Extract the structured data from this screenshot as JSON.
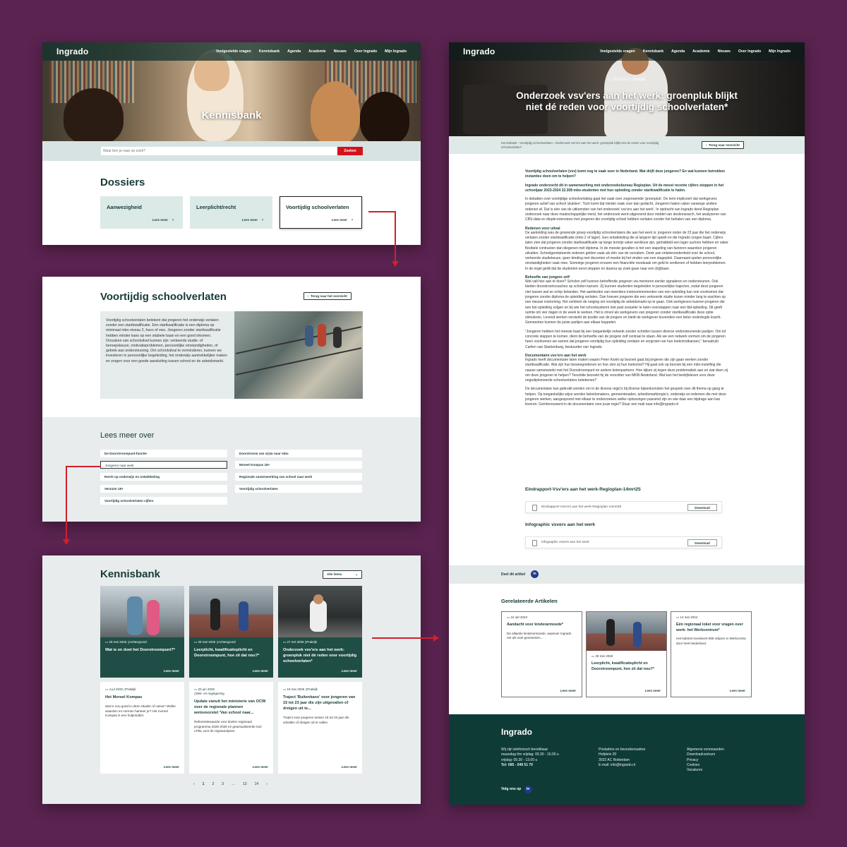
{
  "nav": {
    "logo": "Ingrado",
    "links": [
      "Veelgestelde vragen",
      "Kennisbank",
      "Agenda",
      "Academie",
      "Nieuws",
      "Over Ingrado",
      "Mijn Ingrado"
    ]
  },
  "panel1": {
    "hero_title": "Kennisbank",
    "search_placeholder": "Waar ben je naar op zoek?",
    "search_button": "Zoeken",
    "section_title": "Dossiers",
    "dossiers": [
      {
        "title": "Aanwezigheid",
        "more": "Lees meer"
      },
      {
        "title": "Leerplicht/recht",
        "more": "Lees meer"
      },
      {
        "title": "Voortijdig schoolverlaten",
        "more": "Lees meer"
      }
    ]
  },
  "panel2": {
    "title": "Voortijdig schoolverlaten",
    "back": "Terug naar het overzicht",
    "intro": "Voortijdig schoolverlaten betekent dat jongeren het onderwijs verlaten zonder een startkwalificatie. Een startkwalificatie is een diploma op minimaal mbo-niveau 2, havo of vwo. Jongeren zonder startkwalificatie hebben minder kans op een stabiele baan en een goed inkomen. Oorzaken van schooluitval kunnen zijn: verkeerde studie- of beroepskeuze, motivatieproblemen, persoonlijke omstandigheden, of gebrek aan ondersteuning. Om schooluitval te verminderen, kunnen we investeren in persoonlijke begeleiding, het onderwijs aantrekkelijker maken en zorgen voor een goede aansluiting tussen school en de arbeidsmarkt.",
    "read_more_title": "Lees meer over",
    "links_left": [
      "De Doorstroompunt-functie",
      "Jongeren naar werk",
      "Recht op onderwijs en ontwikkeling",
      "Verzuim 18+",
      "Voortijdig schoolverlaten cijfers"
    ],
    "links_right": [
      "Doorstroom van v(s)o naar mbo",
      "Moreel Kompas 18+",
      "Regionale samenwerking van school naar werk",
      "Voortijdig schoolverlaten"
    ]
  },
  "panel3": {
    "title": "Kennisbank",
    "filter": "Alle items",
    "cards": [
      {
        "meta": "29 mei 2025",
        "tag": "Achtergrond",
        "title": "Wat is en doet het Doorstroompunt?*",
        "desc": "",
        "more": "Lees meer"
      },
      {
        "meta": "29 mei 2025",
        "tag": "Achtergrond",
        "title": "Leerplicht, kwalificatieplicht en Doorstroompunt, hoe zit dat nou?*",
        "desc": "",
        "more": "Lees meer"
      },
      {
        "meta": "27 mrt 2025",
        "tag": "Praktijk",
        "title": "Onderzoek vsv'ers aan het werk: groenpluk niet dé reden voor voortijdig schoolverlaten*",
        "desc": "",
        "more": "Lees meer"
      },
      {
        "meta": "4 jul 2025",
        "tag": "Praktijk",
        "title": "Het Moreel Kompas",
        "desc": "Wat is nou goed in deze situatie of casus? Welke waarden en normen hanteer je? Het moreel Kompas is een hulpmiddel.",
        "more": "Lees meer"
      },
      {
        "meta": "20 jun 2025",
        "tag": "Wet- en regelgeving",
        "title": "Update vanuit het ministerie van OCW over de regionale plannen wetsvoorstel 'Van school naar...",
        "desc": "Referentiewaarde voor doelen regionaal programma 2026-2029 en geactualiseerde tool LPBL voor de regioanalyses.",
        "more": "Lees meer"
      },
      {
        "meta": "19 mei 2025",
        "tag": "Praktijk",
        "title": "Traject 'Buitenkans' voor jongeren van 15 tot 23 jaar die zijn uitgevallen of dreigen uit te...",
        "desc": "Traject voor jongeren tussen 15 tot 23 jaar die uitvallen of dreigen uit te vallen",
        "more": "Lees meer"
      }
    ],
    "pager": [
      "‹",
      "1",
      "2",
      "3",
      "…",
      "13",
      "14",
      "›"
    ]
  },
  "panel4": {
    "meta_date": "2025-03-27",
    "meta_tag": "Praktijk",
    "hero_title": "Onderzoek vsv'ers aan het werk: groenpluk blijkt niet dé reden voor voortijdig schoolverlaten*",
    "breadcrumb": "Kennisbank  ›  Voortijdig schoolverlaten  ›  Onderzoek vsv'ers aan het werk: groenpluk blijkt niet de reden voor voortijdig schoolverlaten*",
    "back": "Terug naar overzicht",
    "lead1": "Voortijdig schoolverlaten (vsv) komt nog te vaak voor in Nederland. Wat drijft deze jongeren? En wat kunnen betrokken instanties doen om te helpen?",
    "lead2": "Ingrado onderzocht dit in samenwerking met onderzoeksbureau Regioplan. Uit de meest recente cijfers stoppen in het schooljaar 2023-2024 22.308 mbo-studenten met hun opleiding zonder startkwalificatie te halen.",
    "p1": "In debatten over voortijdige schoolverlating gaat het vaak over zogenoemde 'groenpluk'. De term impliceert dat werkgevers jongeren actief van school 'plukken'. Toch komt dat minder vaak voor dan gedacht. Jongeren haken vaker vanwege andere redenen af. Dat is één van de uitkomsten van het onderzoek 'vsv'ers aan het werk'. In opdracht van Ingrado deed Regioplan onderzoek naar deze maatschappelijke trend, het onderzoek werd uitgevoerd door middel van deskresearch, het analyseren van CBS-data en diepte-interviews met jongeren die voortijdig school hebben verlaten zonder het behalen van een diploma.",
    "h1": "Redenen voor uitval",
    "p2": "De aanleiding was de groeiende groep voortijdig schoolverlaters die aan het werk is: jongeren onder de 23 jaar die het onderwijs verlaten zonder startkwalificatie (mbo 2 of lager). Een ontwikkeling die al langere tijd speelt en die Ingrado zorgen baart. Cijfers laten zien dat jongeren zonder startkwalificatie op lange termijn vaker werkloos zijn, gemiddeld een lager uurloon hebben en vaker flexibele contracten dan diegenen mét diploma. In de meeste gevallen is het een stapeling van factoren waardoor jongeren uitvallen. Schoolgerelateerde redenen gelden vaak als één van de oorzaken. Denk aan onbetevredenheid over de school, verkeerde studiekeuze, geen binding met docenten of moeite bij het vinden van een stageplek. Daarnaast spelen persoonlijke omstandigheden vaak mee. Sommige jongeren ervaren een financiële noodzaak om geld te verdienen of hebben leerproblemen. In de regel geldt dat de studenten eerst stoppen en daarna op zoek gaan naar een (bij)baan.",
    "h2": "Behoefte van jongere zelf",
    "p3": "Wat valt hier aan te doen? Scholen zelf kunnen betreffende jongeren via mentoren eerder signaleren en ondersteunen. Ook bieden doorstroomcoaches op scholen kansen. Zij kunnen studenten begeleiden in persoonlijke trajecten, zodat deze jongeren niet tussen wal en schip belanden. Het aanbieden van meerdere instroommomenten van een opleiding kan ook voorkomen dat jongeren zonder diploma de opleiding verlaten. Dan hoeven jongeren die een verkeerde studie kozen minder lang te wachten op een nieuwe instroming. Het verkleint de neiging om voortijdig de arbeidsmarkt op te gaan. Ook werkgevers kunnen jongeren die een bol-opleiding volgen en bij wie het schoolsysteem niet past soepeler te laten overstappen naar een bbl-opleiding. Dit geeft ruimte om vier dagen in de week te werken. Het is zinvol als werkgevers van jongeren zonder startkwalificatie deze optie stimuleren. Levend werken versterkt de positie van de jongere en biedt de werkgever bovendien een beter onderlegde kracht. Gemeenten kunnen de juiste partijen aan elkaar koppelen.",
    "p4": "\"Jongeren hebben het meeste baat bij een toegankelijk netwerk zonder schotten tussen diverse ondersteunende partijen. Om tot concrete stappen te komen, dient de behoefte van de jongere zelf centraal te staan. Als we een netwerk vormen om de jongeren heen voorkomen we samen dat jongeren voortijdig hun opleiding verlaten en vergroten we hun toekomstkansen,\" benadrukt Carlien van Starkenburg, bestuurder van Ingrado.",
    "h3": "Documentaire vsv'ers aan het werk",
    "p5": "Ingrado heeft documentaire laten maken waarin Peter Kwint op bezoek gaat bij jongeren die zijn gaan werken zonder startkwalificatie. Wat zijn hun beweegredenen en hoe zien zij hun toekomst? Hij gaat ook op bezoek bij een mbo-instelling die nauwe samenwerkt met het Doorstroompunt en andere ketenpartners. Hoe kijken zij tegen deze problematiek aan en wat doen zij om deze jongeren te helpen? Tenslotte bezoekt hij de voorzitter van MKB-Nederland. Wat kan het bedrijfsleven voor deze ongediplomeerde schoolverlaters betekenen?",
    "p6": "De documentaire kan gebruikt worden om in de diverse regio's bij diverse bijeenkomsten het gesprek over dit thema op gang te helpen. Op toegankelijke wijze worden beleidsmakers, gemeenteraden, arbeidsmarktregio's, onderwijs en iedereen die met deze jongeren werken, aangespoord met elkaar te onderzoeken welke oplossingen passend zijn en wie daar een bijdrage aan kan leveren. Geïnteresseerd in de documentaire voor jouw regio? Stuur een mail naar info@ingrado.nl",
    "dl_title1": "Eindrapport-Vsv'ers aan het werk-Regioplan-14mrt25",
    "dl_file1": "Eindrapport-Vsv'ers aan het werk-Regioplan-14mrt25",
    "dl_title2": "Infographic vsvers aan het werk",
    "dl_file2": "Infographic vsvers aan het werk",
    "download": "Download",
    "share": "Deel dit artikel",
    "related_title": "Gerelateerde Artikelen",
    "related": [
      {
        "meta": "24 okt 2023",
        "title": "Aandacht voor kinderarmoede*",
        "desc": "De alliantie kinderarmoede, waarvan Ingrado net als veel gemeenten...",
        "more": "Lees meer"
      },
      {
        "meta": "29 mei 2025",
        "title": "Leerplicht, kwalificatieplicht en Doorstroompunt, hoe zit dat nou?*",
        "desc": "",
        "more": "Lees meer"
      },
      {
        "meta": "14 mei 2024",
        "title": "Eén regionaal loket voor vragen over werk: het Werkcentrum*",
        "desc": "Het kabinet investeert €86 miljoen in Werkcentra door heel Nederland.",
        "more": "Lees meer"
      }
    ],
    "footer": {
      "logo": "Ingrado",
      "col1": [
        "Wij zijn telefonisch bereikbaar",
        "maandag t/m vrijdag: 09.30 - 16.00 u",
        "vrijdag: 09.30 - 13.00 u",
        "Tel: 085 - 049 51 70"
      ],
      "col2": [
        "Postadres en bezoekersadres",
        "Hofplein 20",
        "3032 AC Rotterdam",
        "E-mail: info@ingrado.nl"
      ],
      "col3": [
        "Algemene voorwaarden",
        "Downloadcentrum",
        "Privacy",
        "Cookies",
        "Vacatures"
      ],
      "follow": "Volg ons op"
    }
  },
  "colors": {
    "brand_dark": "#173b37",
    "accent_red": "#d3121e",
    "mint": "#dceae7",
    "background": "#5a2350"
  }
}
